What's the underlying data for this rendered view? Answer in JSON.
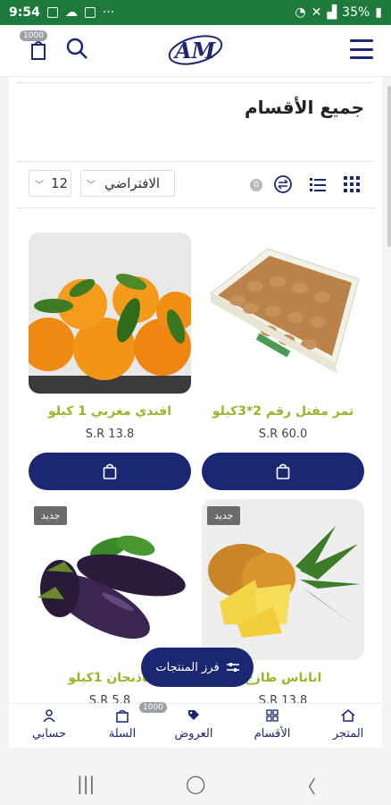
{
  "status_bar": {
    "time": "9:54",
    "battery": "35%"
  },
  "header": {
    "cart_count": "1000",
    "logo_text": "AM"
  },
  "page": {
    "title": "جميع الأقسام"
  },
  "toolbar": {
    "per_page": "12",
    "sort": "الافتراضي",
    "info": "0"
  },
  "products": [
    {
      "name": "تمر مفتل رقم 2*3كيلو",
      "price": "S.R 60.0",
      "badge": ""
    },
    {
      "name": "افندي مغربي 1 كيلو",
      "price": "S.R 13.8",
      "badge": ""
    },
    {
      "name": "اناناس طازج",
      "price": "S.R 13.8",
      "badge": "جديد"
    },
    {
      "name": "باذنجان 1كيلو",
      "price": "S.R 5.8",
      "badge": "جديد"
    }
  ],
  "filter_button": {
    "label": "فرز المنتجات"
  },
  "bottom_nav": {
    "store": "المتجر",
    "categories": "الأقسام",
    "offers": "العروض",
    "cart": "السلة",
    "cart_badge": "1000",
    "account": "حسابي"
  },
  "colors": {
    "primary": "#1b2772",
    "accent": "#9bb52a",
    "status": "#1e7a3c"
  }
}
